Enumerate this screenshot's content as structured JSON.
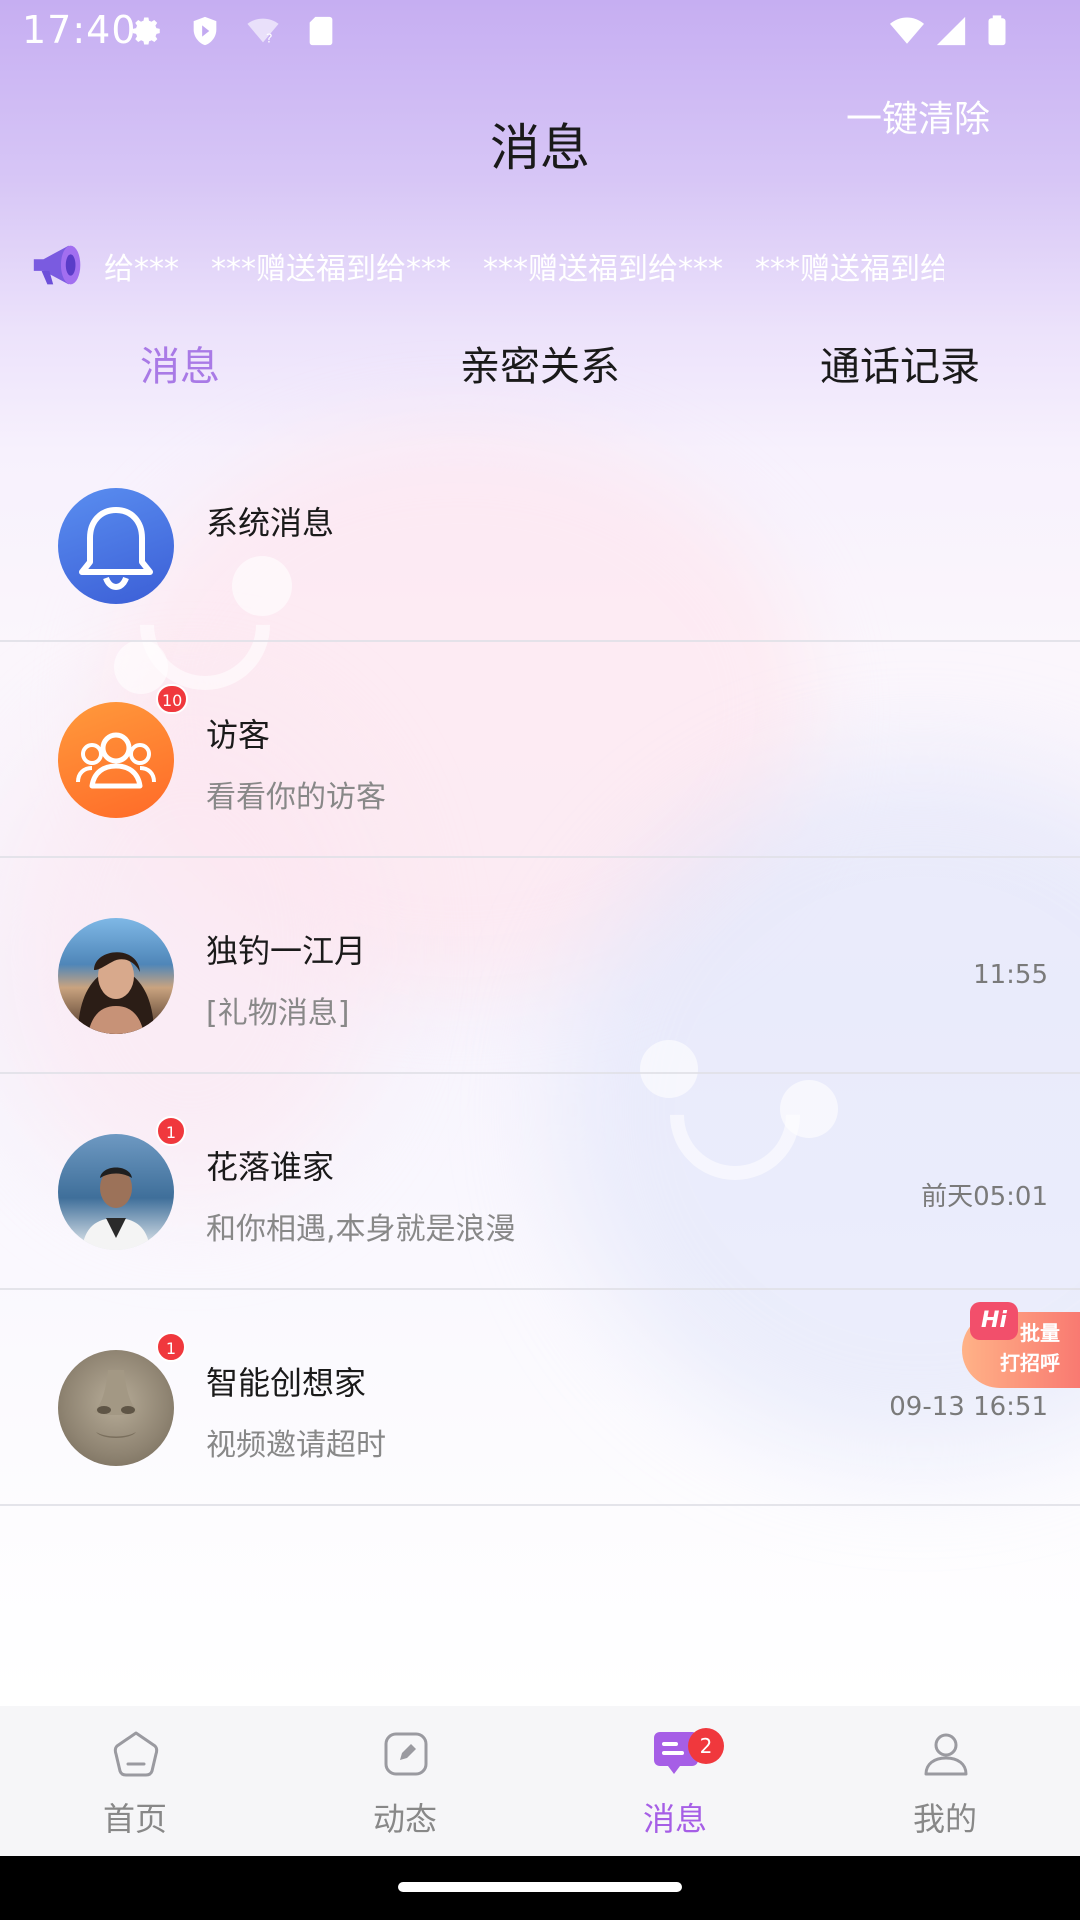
{
  "status_bar": {
    "time": "17:40"
  },
  "header": {
    "title": "消息",
    "clear_label": "一键清除"
  },
  "marquee": {
    "items": [
      "给***",
      "***赠送福到给***",
      "***赠送福到给***",
      "***赠送福到给"
    ]
  },
  "tabs": [
    {
      "label": "消息",
      "active": true
    },
    {
      "label": "亲密关系",
      "active": false
    },
    {
      "label": "通话记录",
      "active": false
    }
  ],
  "conversations": [
    {
      "title": "系统消息",
      "subtitle": "",
      "time": "",
      "badge": "",
      "avatar": "bell-icon"
    },
    {
      "title": "访客",
      "subtitle": "看看你的访客",
      "time": "",
      "badge": "10",
      "avatar": "visitors-icon"
    },
    {
      "title": "独钓一江月",
      "subtitle": "[礼物消息]",
      "time": "11:55",
      "badge": "",
      "avatar": "user-photo"
    },
    {
      "title": "花落谁家",
      "subtitle": "和你相遇,本身就是浪漫",
      "time": "前天05:01",
      "badge": "1",
      "avatar": "user-photo"
    },
    {
      "title": "智能创想家",
      "subtitle": "视频邀请超时",
      "time": "09-13  16:51",
      "badge": "1",
      "avatar": "user-photo"
    }
  ],
  "hi_button": {
    "tag": "Hi",
    "line1": "批量",
    "line2": "打招呼"
  },
  "bottom_nav": [
    {
      "label": "首页",
      "icon": "home-icon",
      "active": false
    },
    {
      "label": "动态",
      "icon": "edit-icon",
      "active": false
    },
    {
      "label": "消息",
      "icon": "message-icon",
      "active": true,
      "badge": "2"
    },
    {
      "label": "我的",
      "icon": "profile-icon",
      "active": false
    }
  ],
  "colors": {
    "accent": "#a97ae6",
    "badge": "#f0383d",
    "system_bell_bg": "#4a72e0",
    "visitor_bg": "#ff7b2c"
  }
}
